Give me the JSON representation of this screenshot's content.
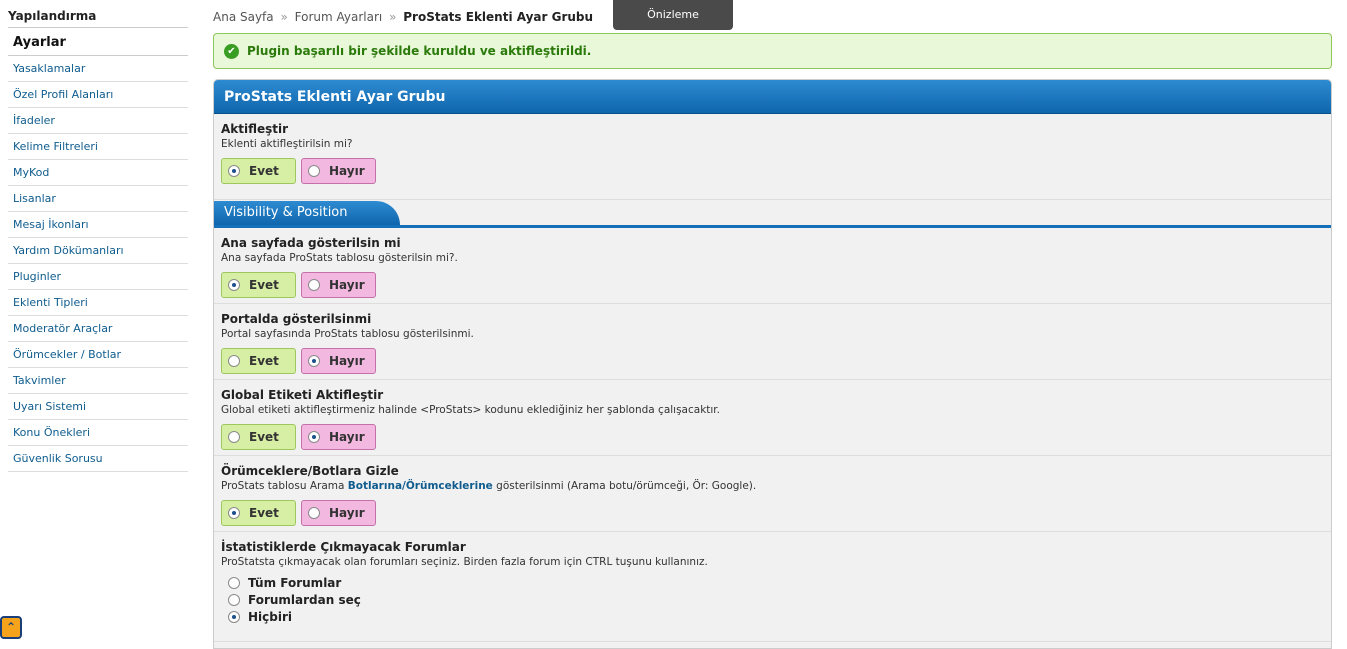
{
  "sidebar": {
    "header": "Yapılandırma",
    "title": "Ayarlar",
    "items": [
      "Yasaklamalar",
      "Özel Profil Alanları",
      "İfadeler",
      "Kelime Filtreleri",
      "MyKod",
      "Lisanlar",
      "Mesaj İkonları",
      "Yardım Dökümanları",
      "Pluginler",
      "Eklenti Tipleri",
      "Moderatör Araçlar",
      "Örümcekler / Botlar",
      "Takvimler",
      "Uyarı Sistemi",
      "Konu Önekleri",
      "Güvenlik Sorusu"
    ]
  },
  "breadcrumb": {
    "home": "Ana Sayfa",
    "sep": "»",
    "forum_settings": "Forum Ayarları",
    "current": "ProStats Eklenti Ayar Grubu"
  },
  "preview_label": "Önizleme",
  "success_message": "Plugin başarılı bir şekilde kuruldu ve aktifleştirildi.",
  "panel_title": "ProStats Eklenti Ayar Grubu",
  "section_title": "Visibility & Position",
  "yes_label": "Evet",
  "no_label": "Hayır",
  "settings": [
    {
      "title": "Aktifleştir",
      "desc": "Eklenti aktifleştirilsin mi?",
      "value": "yes"
    },
    {
      "title": "Ana sayfada gösterilsin mi",
      "desc": "Ana sayfada ProStats tablosu gösterilsin mi?.",
      "value": "yes"
    },
    {
      "title": "Portalda gösterilsinmi",
      "desc": "Portal sayfasında ProStats tablosu gösterilsinmi.",
      "value": "no"
    },
    {
      "title": "Global Etiketi Aktifleştir",
      "desc": "Global etiketi aktifleştirmeniz halinde <ProStats> kodunu eklediğiniz her şablonda çalışacaktır.",
      "value": "no"
    },
    {
      "title": "Örümceklere/Botlara Gizle",
      "desc_pre": "ProStats tablosu Arama ",
      "desc_link": "Botlarına/Örümceklerine",
      "desc_post": " gösterilsinmi (Arama botu/örümceği, Ör: Google).",
      "value": "yes"
    }
  ],
  "forums_setting": {
    "title": "İstatistiklerde Çıkmayacak Forumlar",
    "desc": "ProStatsta çıkmayacak olan forumları seçiniz. Birden fazla forum için CTRL tuşunu kullanınız.",
    "options": [
      "Tüm Forumlar",
      "Forumlardan seç",
      "Hiçbiri"
    ],
    "selected": 2
  },
  "corner_button_icon": "chevron-up-icon"
}
